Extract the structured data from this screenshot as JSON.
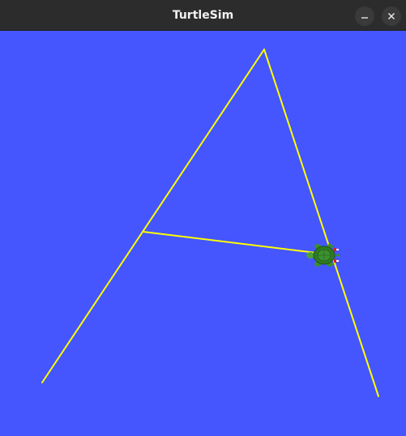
{
  "window": {
    "title": "TurtleSim",
    "background_color": "#4556ff",
    "titlebar_color": "#2c2c2c",
    "buttons": [
      {
        "name": "minimize",
        "icon": "minimize-icon"
      },
      {
        "name": "close",
        "icon": "close-icon"
      }
    ]
  },
  "simulation": {
    "pen_color": "#ffff00",
    "path_shape": "letter A",
    "turtle_icon": "turtle-icon",
    "turtle_heading": "west"
  }
}
